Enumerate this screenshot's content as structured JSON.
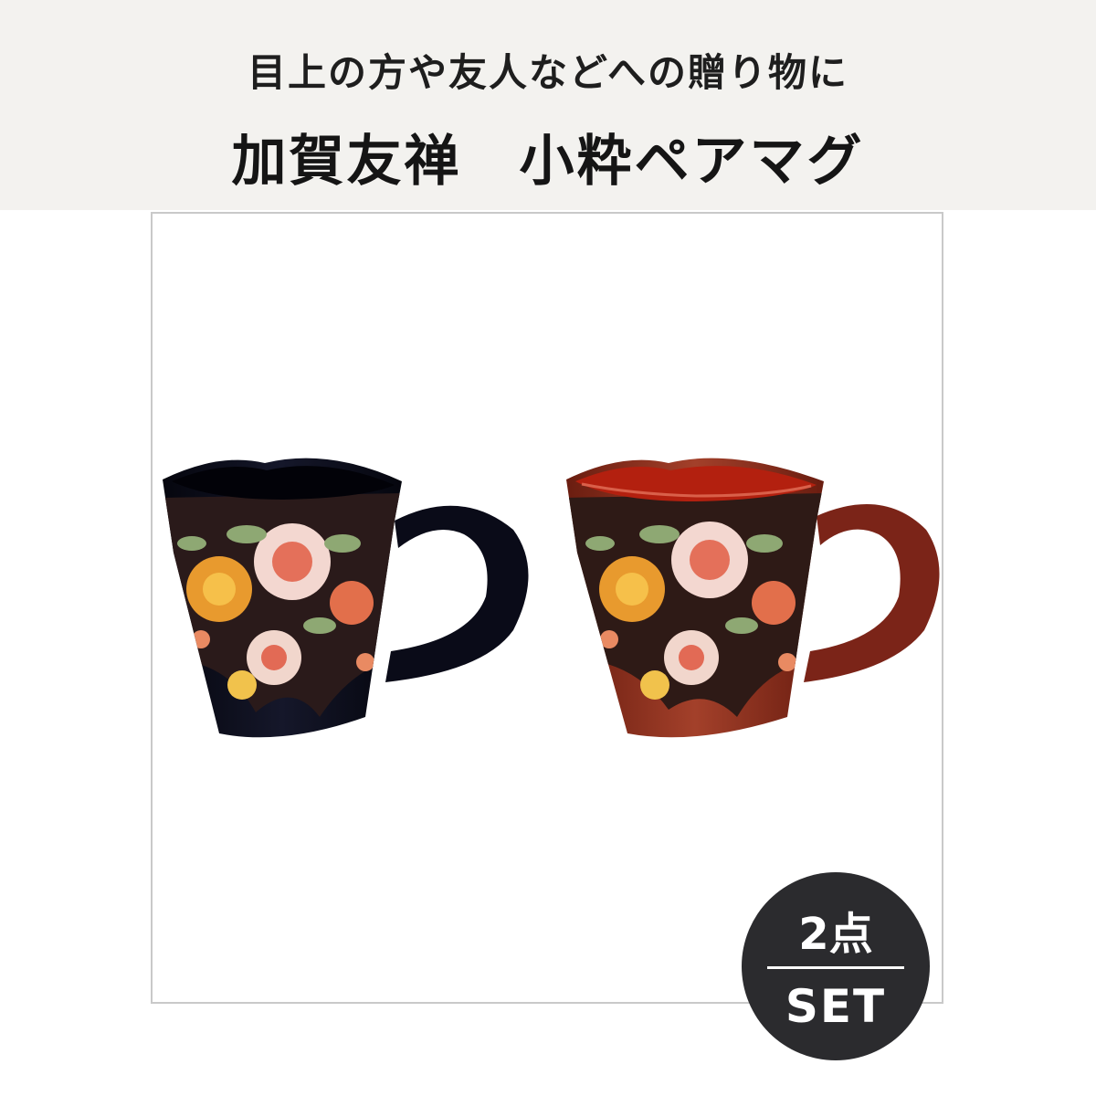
{
  "header": {
    "subtitle": "目上の方や友人などへの贈り物に",
    "title": "加賀友禅　小粋ペアマグ"
  },
  "product": {
    "mugs": [
      {
        "name": "black-mug",
        "body_color": "#0c0d1a"
      },
      {
        "name": "red-mug",
        "body_color": "#8a2a1a"
      }
    ]
  },
  "badge": {
    "top": "2点",
    "bottom": "SET"
  },
  "colors": {
    "header_bg": "#f3f2ef",
    "badge_bg": "#2b2b2e"
  }
}
